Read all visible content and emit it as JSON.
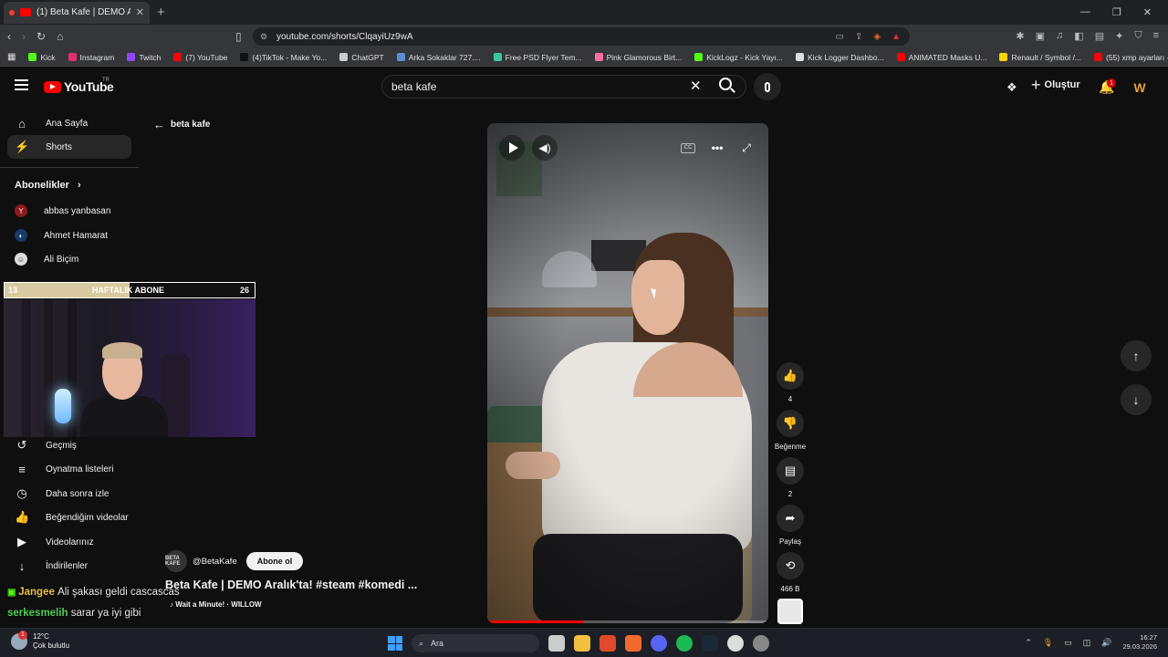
{
  "browser": {
    "tab_title": "(1) Beta Kafe | DEMO Aralık'ta!",
    "tab_close": "✕",
    "new_tab": "+",
    "url": "youtube.com/shorts/ClqayiUz9wA",
    "window_controls": [
      "—",
      "❐",
      "✕"
    ],
    "bookmarks": [
      {
        "label": "Kick",
        "color": "#53fc18"
      },
      {
        "label": "Instagram",
        "color": "#e1306c"
      },
      {
        "label": "Twitch",
        "color": "#9146ff"
      },
      {
        "label": "(7) YouTube",
        "color": "#ff0000"
      },
      {
        "label": "(4)TikTok - Make Yo...",
        "color": "#111111"
      },
      {
        "label": "ChatGPT",
        "color": "#cccccc"
      },
      {
        "label": "Arka Sokaklar 727....",
        "color": "#5b8dd6"
      },
      {
        "label": "Free PSD Flyer Tem...",
        "color": "#39c6a0"
      },
      {
        "label": "Pink Glamorous Birt...",
        "color": "#ff6fa5"
      },
      {
        "label": "KickLogz - Kick Yayı...",
        "color": "#53fc18"
      },
      {
        "label": "Kick Logger Dashbo...",
        "color": "#dddddd"
      },
      {
        "label": "ANIMATED Masks U...",
        "color": "#ff0000"
      },
      {
        "label": "Renault / Symbol /...",
        "color": "#ffd400"
      },
      {
        "label": "(55) xmp ayarları - Y...",
        "color": "#ff0000"
      }
    ]
  },
  "header": {
    "logo": "YouTube",
    "logo_region": "TR",
    "search_value": "beta kafe",
    "create_label": "Oluştur",
    "notification_count": "1"
  },
  "sidebar": {
    "items": [
      {
        "label": "Ana Sayfa",
        "icon": "⌂"
      },
      {
        "label": "Shorts",
        "icon": "⚡"
      }
    ],
    "subscriptions_heading": "Abonelikler",
    "subscriptions": [
      {
        "label": "abbas yanbasan",
        "initial": "Y",
        "color": "#8b1a1a"
      },
      {
        "label": "Ahmet Hamarat",
        "initial": "◐",
        "color": "#1a3a6a"
      },
      {
        "label": "Ali Biçim",
        "initial": "☺",
        "color": "#dddddd"
      }
    ],
    "lower_items": [
      {
        "label": "Geçmiş",
        "icon": "↺"
      },
      {
        "label": "Oynatma listeleri",
        "icon": "≡"
      },
      {
        "label": "Daha sonra izle",
        "icon": "◷"
      },
      {
        "label": "Beğendiğim videolar",
        "icon": "👍"
      },
      {
        "label": "Videolarınız",
        "icon": "▶"
      },
      {
        "label": "İndirilenler",
        "icon": "↓"
      }
    ]
  },
  "overlay": {
    "left_value": "13",
    "label": "HAFTALIK ABONE",
    "right_value": "26",
    "progress": 0.5
  },
  "back_label": "beta kafe",
  "video": {
    "progress": 0.34,
    "cc_label": "CC"
  },
  "actions": {
    "like_count": "4",
    "dislike_label": "Beğenme",
    "comment_count": "2",
    "share_label": "Paylaş",
    "remix_count": "466 B"
  },
  "info": {
    "channel_handle": "@BetaKafe",
    "channel_avatar_text": "BETA KAFE",
    "subscribe_label": "Abone ol",
    "title": "Beta Kafe | DEMO Aralık'ta! #steam #komedi ...",
    "music": "Wait a Minute! · WILLOW"
  },
  "chat": [
    {
      "user": "Jangee",
      "message": "Ali şakası geldi cascascas"
    },
    {
      "user": "serkesmelih",
      "message": "sarar ya iyi gibi"
    }
  ],
  "taskbar": {
    "temperature": "12°C",
    "weather_text": "Çok bulutlu",
    "weather_badge": "1",
    "search_label": "Ara",
    "time": "16:27",
    "date": "29.03.2026"
  }
}
